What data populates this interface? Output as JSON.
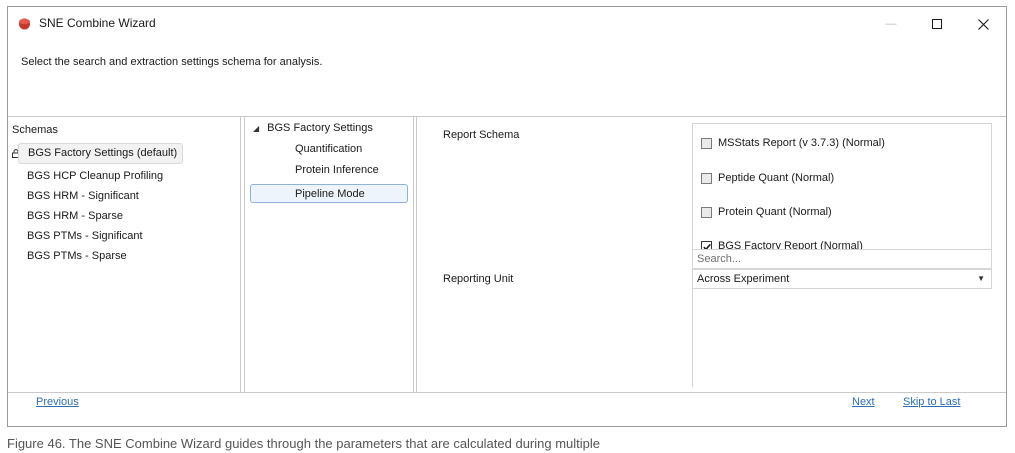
{
  "window": {
    "title": "SNE Combine Wizard",
    "minimize_glyph": "—",
    "accent_icon_color": "#c0392b"
  },
  "instruction": "Select the search and extraction settings schema for  analysis.",
  "schemas": {
    "header": "Schemas",
    "items": [
      {
        "label": "BGS Factory Settings (default)",
        "selected": true,
        "icon": "lock-icon"
      },
      {
        "label": "BGS HCP Cleanup Profiling"
      },
      {
        "label": "BGS HRM - Significant"
      },
      {
        "label": "BGS HRM - Sparse"
      },
      {
        "label": "BGS PTMs - Significant"
      },
      {
        "label": "BGS PTMs - Sparse"
      }
    ]
  },
  "tree": {
    "root_label": "BGS Factory Settings",
    "children": [
      {
        "label": "Quantification"
      },
      {
        "label": "Protein Inference"
      },
      {
        "label": "Pipeline Mode",
        "selected": true
      }
    ]
  },
  "settings": {
    "report_schema_label": "Report Schema",
    "reporting_unit_label": "Reporting Unit",
    "reports": [
      {
        "label": "MSStats Report (v 3.7.3) (Normal)",
        "checked": false
      },
      {
        "label": "Peptide Quant (Normal)",
        "checked": false
      },
      {
        "label": "Protein Quant (Normal)",
        "checked": false
      },
      {
        "label": "BGS Factory Report (Normal)",
        "checked": true
      }
    ],
    "search_placeholder": "Search...",
    "reporting_unit_value": "Across Experiment"
  },
  "footer": {
    "previous": "Previous",
    "next": "Next",
    "skip": "Skip to Last"
  },
  "caption": "Figure 46. The SNE Combine Wizard guides through the parameters that are calculated during multiple"
}
